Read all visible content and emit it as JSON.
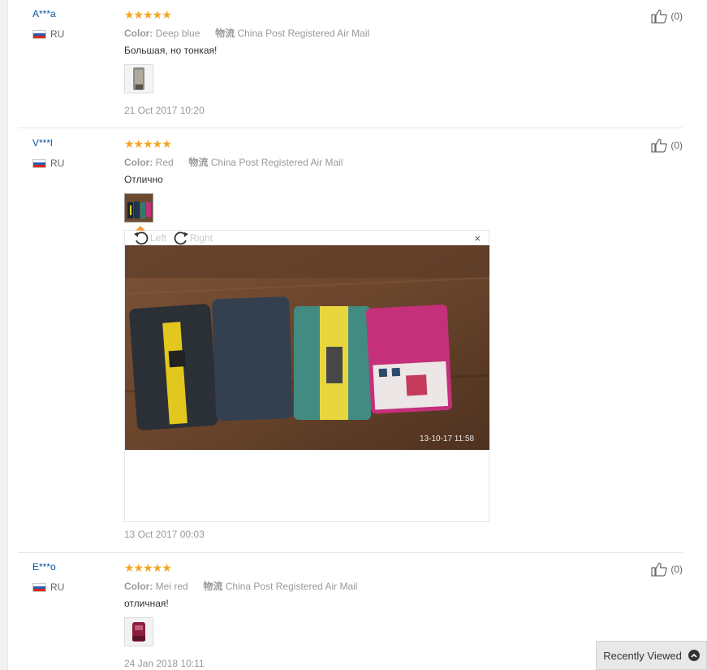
{
  "reviews": [
    {
      "user": "A***a",
      "country": "RU",
      "stars": "★★★★★",
      "color_label": "Color:",
      "color_value": "Deep blue",
      "logistics_label": "物流",
      "logistics_value": "China Post Registered Air Mail",
      "text": "Большая, но тонкая!",
      "date": "21 Oct 2017 10:20",
      "likes": "(0)"
    },
    {
      "user": "V***l",
      "country": "RU",
      "stars": "★★★★★",
      "color_label": "Color:",
      "color_value": "Red",
      "logistics_label": "物流",
      "logistics_value": "China Post Registered Air Mail",
      "text": "Отлично",
      "date": "13 Oct 2017 00:03",
      "likes": "(0)"
    },
    {
      "user": "E***o",
      "country": "RU",
      "stars": "★★★★★",
      "color_label": "Color:",
      "color_value": "Mei red",
      "logistics_label": "物流",
      "logistics_value": "China Post Registered Air Mail",
      "text": "отличная!",
      "date": "24 Jan 2018 10:11",
      "likes": "(0)"
    }
  ],
  "viewer": {
    "rotate_left": "Left",
    "rotate_right": "Right",
    "close": "×",
    "photo_timestamp": "13-10-17 11:58"
  },
  "recently_viewed": "Recently Viewed",
  "colors": {
    "star": "#f5a623",
    "username": "#0055aa",
    "muted": "#999999"
  },
  "icons": [
    "thumbs-up-icon",
    "rotate-left-icon",
    "rotate-right-icon",
    "close-icon",
    "chevron-up-icon",
    "flag-ru-icon"
  ]
}
